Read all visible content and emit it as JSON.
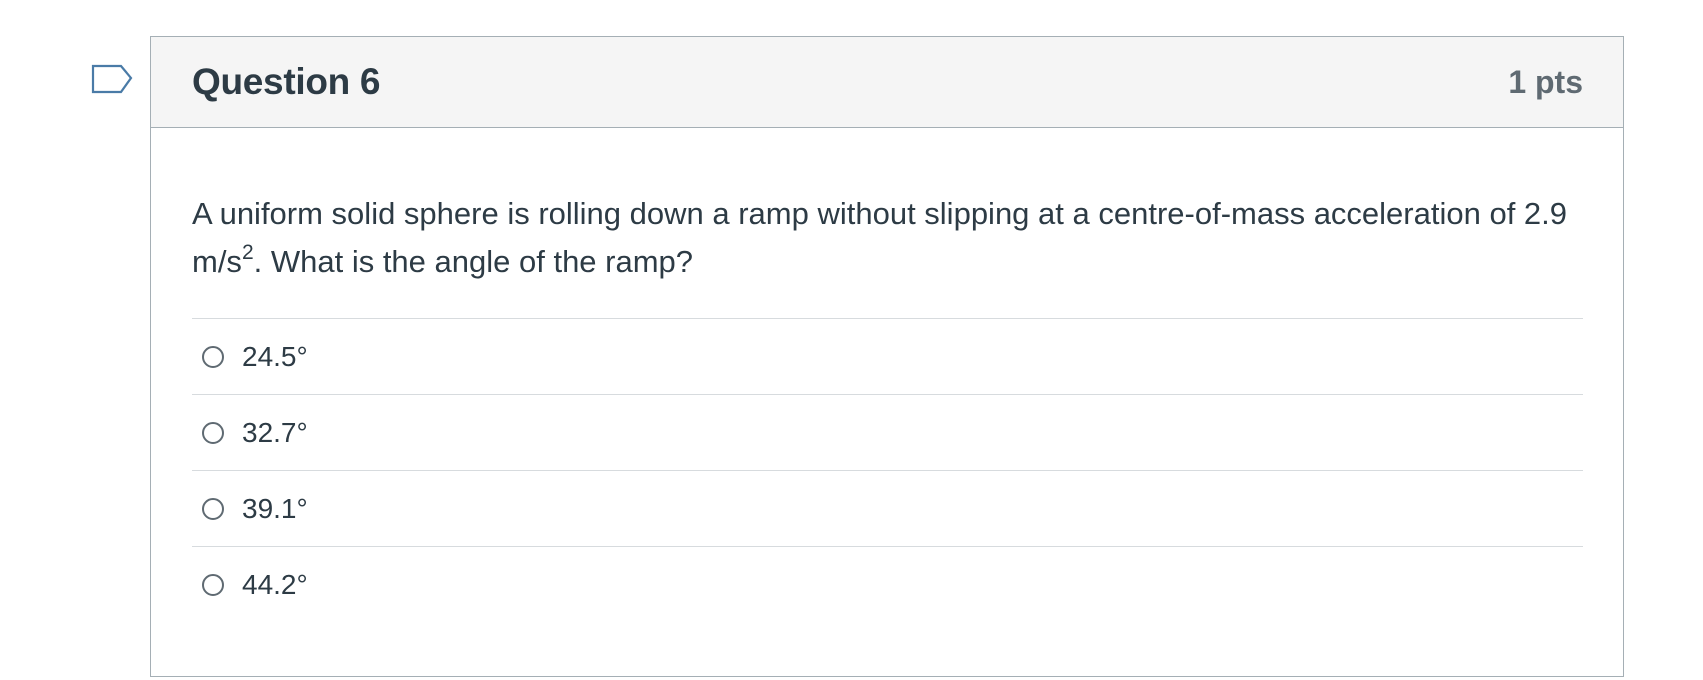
{
  "question": {
    "title": "Question 6",
    "points": "1 pts",
    "text_before_sup": "A uniform solid sphere is rolling down a ramp without slipping at a centre-of-mass acceleration of 2.9 m/s",
    "text_sup": "2",
    "text_after_sup": ". What is the angle of the ramp?"
  },
  "answers": [
    {
      "label": "24.5°",
      "selected": false
    },
    {
      "label": "32.7°",
      "selected": false
    },
    {
      "label": "39.1°",
      "selected": false
    },
    {
      "label": "44.2°",
      "selected": false
    }
  ],
  "icons": {
    "flag": "flag-question-icon"
  },
  "colors": {
    "header_bg": "#f5f5f5",
    "border": "#a5afb5",
    "text": "#2d3b45",
    "points_text": "#5f6a72",
    "flag_stroke": "#4a7ba7"
  }
}
